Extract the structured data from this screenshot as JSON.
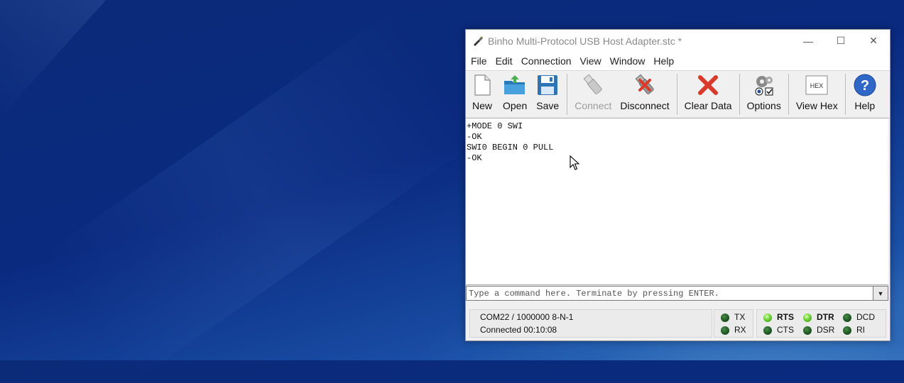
{
  "window": {
    "title": "Binho Multi-Protocol USB Host Adapter.stc *",
    "controls": {
      "minimize": "—",
      "maximize": "☐",
      "close": "✕"
    }
  },
  "menu": [
    "File",
    "Edit",
    "Connection",
    "View",
    "Window",
    "Help"
  ],
  "toolbar": {
    "new": "New",
    "open": "Open",
    "save": "Save",
    "connect": "Connect",
    "disconnect": "Disconnect",
    "clear": "Clear Data",
    "options": "Options",
    "viewhex": "View Hex",
    "help": "Help",
    "hex_icon_text": "HEX"
  },
  "output": {
    "lines": [
      "+MODE 0 SWI",
      "-OK",
      "SWI0 BEGIN 0 PULL",
      "-OK"
    ]
  },
  "command": {
    "placeholder": "Type a command here. Terminate by pressing ENTER.",
    "value": ""
  },
  "status": {
    "port": "COM22 / 1000000 8-N-1",
    "connection": "Connected 00:10:08",
    "tx": "TX",
    "rx": "RX",
    "rts": "RTS",
    "cts": "CTS",
    "dtr": "DTR",
    "dsr": "DSR",
    "dcd": "DCD",
    "ri": "RI",
    "leds": {
      "tx": false,
      "rx": false,
      "rts": true,
      "cts": false,
      "dtr": true,
      "dsr": false,
      "dcd": false,
      "ri": false
    }
  },
  "colors": {
    "led_on": "#6fd23a",
    "led_off": "#1f5a22",
    "close_red": "#d93a2b",
    "help_blue": "#2f67c8"
  }
}
